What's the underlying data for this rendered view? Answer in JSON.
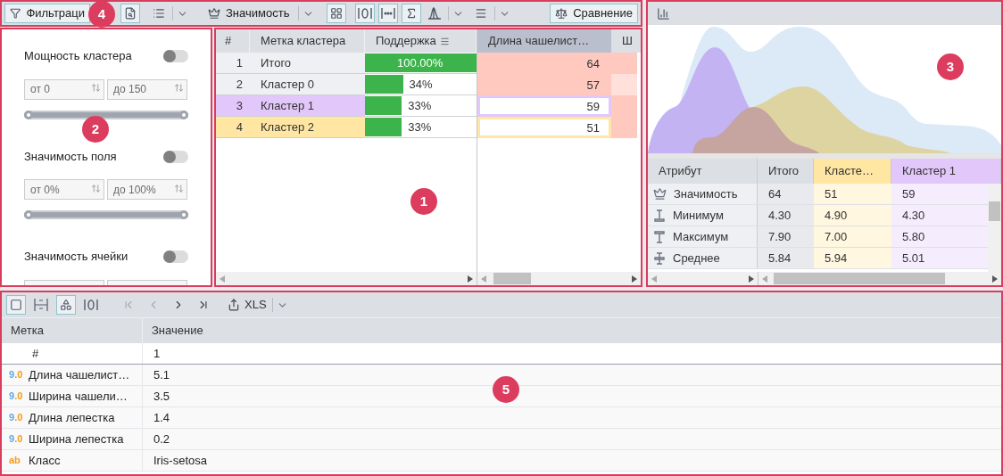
{
  "toolbar": {
    "items": [
      {
        "kind": "labeled",
        "label": "Фильтраци",
        "on": true
      },
      {
        "kind": "toggle",
        "on": true
      },
      {
        "kind": "toggle",
        "on": false
      },
      {
        "kind": "caret"
      },
      {
        "kind": "labeled",
        "label": "Значимость",
        "on": false
      },
      {
        "kind": "caret"
      },
      {
        "kind": "toggle",
        "on": true
      },
      {
        "kind": "toggle",
        "on": true
      },
      {
        "kind": "toggle",
        "on": true
      },
      {
        "kind": "toggle",
        "on": true
      },
      {
        "kind": "toggle",
        "on": false
      },
      {
        "kind": "caret"
      },
      {
        "kind": "toggle",
        "on": false
      },
      {
        "kind": "caret"
      },
      {
        "kind": "labeled",
        "label": "Сравнение",
        "on": true
      }
    ]
  },
  "filters": [
    {
      "label": "Мощность кластера",
      "on": false,
      "fields": [
        {
          "placeholder": "от 0"
        },
        {
          "placeholder": "до 150"
        }
      ],
      "level": 1
    },
    {
      "label": "Значимость поля",
      "on": false,
      "fields": [
        {
          "placeholder": "от 0%"
        },
        {
          "placeholder": "до 100%"
        }
      ],
      "level": 1
    },
    {
      "label": "Значимость ячейки",
      "on": false
    }
  ],
  "table": {
    "columns": [
      {
        "label": "#",
        "sorted": false,
        "selected": false
      },
      {
        "label": "Метка кластера",
        "sorted": false,
        "selected": false
      },
      {
        "label": "Поддержка",
        "sorted": true,
        "selected": false
      },
      {
        "label": "Длина чашелист…",
        "sorted": false,
        "selected": true
      },
      {
        "label": "Ш",
        "sorted": false,
        "selected": false
      }
    ],
    "rows": [
      {
        "num": "1",
        "label": "Итого",
        "color": "#eff0f3",
        "support": "100.00%",
        "level": 1,
        "value": "64",
        "selected": false
      },
      {
        "num": "2",
        "label": "Кластер 0",
        "color": "#eff0f3",
        "support": "34%",
        "level": 0.34,
        "value": "57",
        "selected": false
      },
      {
        "num": "3",
        "label": "Кластер 1",
        "color": "#e2c8fa",
        "support": "33%",
        "level": 0.33,
        "value": "59",
        "selected": true
      },
      {
        "num": "4",
        "label": "Кластер 2",
        "color": "#ffe6a3",
        "support": "33%",
        "level": 0.33,
        "value": "51",
        "selected": true
      }
    ]
  },
  "attributes": {
    "columns": [
      {
        "label": "Атрибут"
      },
      {
        "label": "Итого"
      },
      {
        "label": "Класте…",
        "color": "#ffe6a3"
      },
      {
        "label": "Кластер 1",
        "color": "#e2c8fa"
      }
    ],
    "rows": [
      {
        "label": "Значимость",
        "values": [
          "64",
          "51",
          "59"
        ]
      },
      {
        "label": "Минимум",
        "values": [
          "4.30",
          "4.90",
          "4.30"
        ]
      },
      {
        "label": "Максимум",
        "values": [
          "7.90",
          "7.00",
          "5.80"
        ]
      },
      {
        "label": "Среднее",
        "values": [
          "5.84",
          "5.94",
          "5.01"
        ]
      }
    ]
  },
  "details": {
    "toolbar": [
      {
        "kind": "toggle",
        "on": true
      },
      {
        "kind": "toggle",
        "on": false
      },
      {
        "kind": "toggle",
        "on": true
      },
      {
        "kind": "toggle",
        "on": false
      },
      {
        "kind": "nav",
        "disabled": true
      },
      {
        "kind": "nav",
        "disabled": true
      },
      {
        "kind": "nav",
        "disabled": false
      },
      {
        "kind": "nav",
        "disabled": false
      },
      {
        "kind": "export",
        "label": "XLS"
      },
      {
        "kind": "caret"
      }
    ],
    "columns": [
      "Метка",
      "Значение"
    ],
    "rows": [
      {
        "label": "#",
        "value": "1"
      },
      {
        "kind": "number",
        "badge": "9.0",
        "label": "Длина чашелист…",
        "value": "5.1"
      },
      {
        "kind": "number",
        "badge": "9.0",
        "label": "Ширина чашели…",
        "value": "3.5"
      },
      {
        "kind": "number",
        "badge": "9.0",
        "label": "Длина лепестка",
        "value": "1.4"
      },
      {
        "kind": "number",
        "badge": "9.0",
        "label": "Ширина лепестка",
        "value": "0.2"
      },
      {
        "kind": "text",
        "badge": "ab",
        "label": "Класс",
        "value": "Iris-setosa"
      }
    ]
  },
  "callouts": [
    {
      "label": "4"
    },
    {
      "label": "2"
    },
    {
      "label": "1"
    },
    {
      "label": "3"
    },
    {
      "label": "5"
    }
  ]
}
